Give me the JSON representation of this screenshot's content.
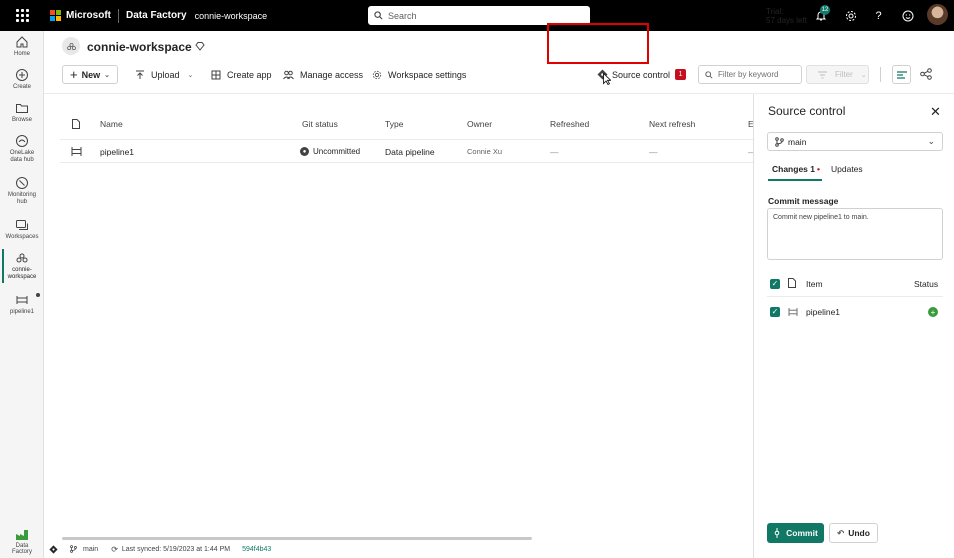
{
  "topbar": {
    "brand": "Microsoft",
    "product": "Data Factory",
    "workspace_crumb": "connie-workspace",
    "search_placeholder": "Search",
    "trial_line1": "Trial:",
    "trial_line2": "57 days left",
    "notifications_count": "12"
  },
  "leftnav": {
    "items": [
      {
        "label": "Home",
        "icon": "home-icon"
      },
      {
        "label": "Create",
        "icon": "plus-circle-icon"
      },
      {
        "label": "Browse",
        "icon": "folder-icon"
      },
      {
        "label": "OneLake",
        "label2": "data hub",
        "icon": "onelake-icon"
      },
      {
        "label": "Monitoring",
        "label2": "hub",
        "icon": "monitor-icon"
      },
      {
        "label": "Workspaces",
        "icon": "workspaces-icon"
      },
      {
        "label": "connie-",
        "label2": "workspace",
        "icon": "workspace-icon"
      },
      {
        "label": "pipeline1",
        "icon": "pipeline-icon"
      }
    ],
    "footer_label": "Data Factory"
  },
  "workspace": {
    "title": "connie-workspace"
  },
  "toolbar": {
    "new_label": "New",
    "upload_label": "Upload",
    "create_app_label": "Create app",
    "manage_access_label": "Manage access",
    "workspace_settings_label": "Workspace settings",
    "source_control_label": "Source control",
    "source_control_badge": "1",
    "filter_keyword_placeholder": "Filter by keyword",
    "filter_label": "Filter"
  },
  "table": {
    "columns": [
      "Name",
      "Git status",
      "Type",
      "Owner",
      "Refreshed",
      "Next refresh",
      "E"
    ],
    "rows": [
      {
        "name": "pipeline1",
        "git_status": "Uncommitted",
        "type": "Data pipeline",
        "owner": "Connie Xu",
        "refreshed": "—",
        "next_refresh": "—",
        "extra": "—"
      }
    ]
  },
  "panel": {
    "title": "Source control",
    "branch": "main",
    "tab_changes": "Changes 1",
    "tab_updates": "Updates",
    "commit_message_label": "Commit message",
    "commit_message_value": "Commit new pipeline1 to main.",
    "col_item": "Item",
    "col_status": "Status",
    "item_name": "pipeline1",
    "commit_button": "Commit",
    "undo_button": "Undo"
  },
  "statusbar": {
    "branch": "main",
    "last_synced": "Last synced: 5/19/2023 at 1:44 PM",
    "commit_hash": "594f4b43"
  },
  "colors": {
    "accent": "#117865",
    "highlight_border": "#e00000",
    "badge_red": "#c50f1f"
  }
}
